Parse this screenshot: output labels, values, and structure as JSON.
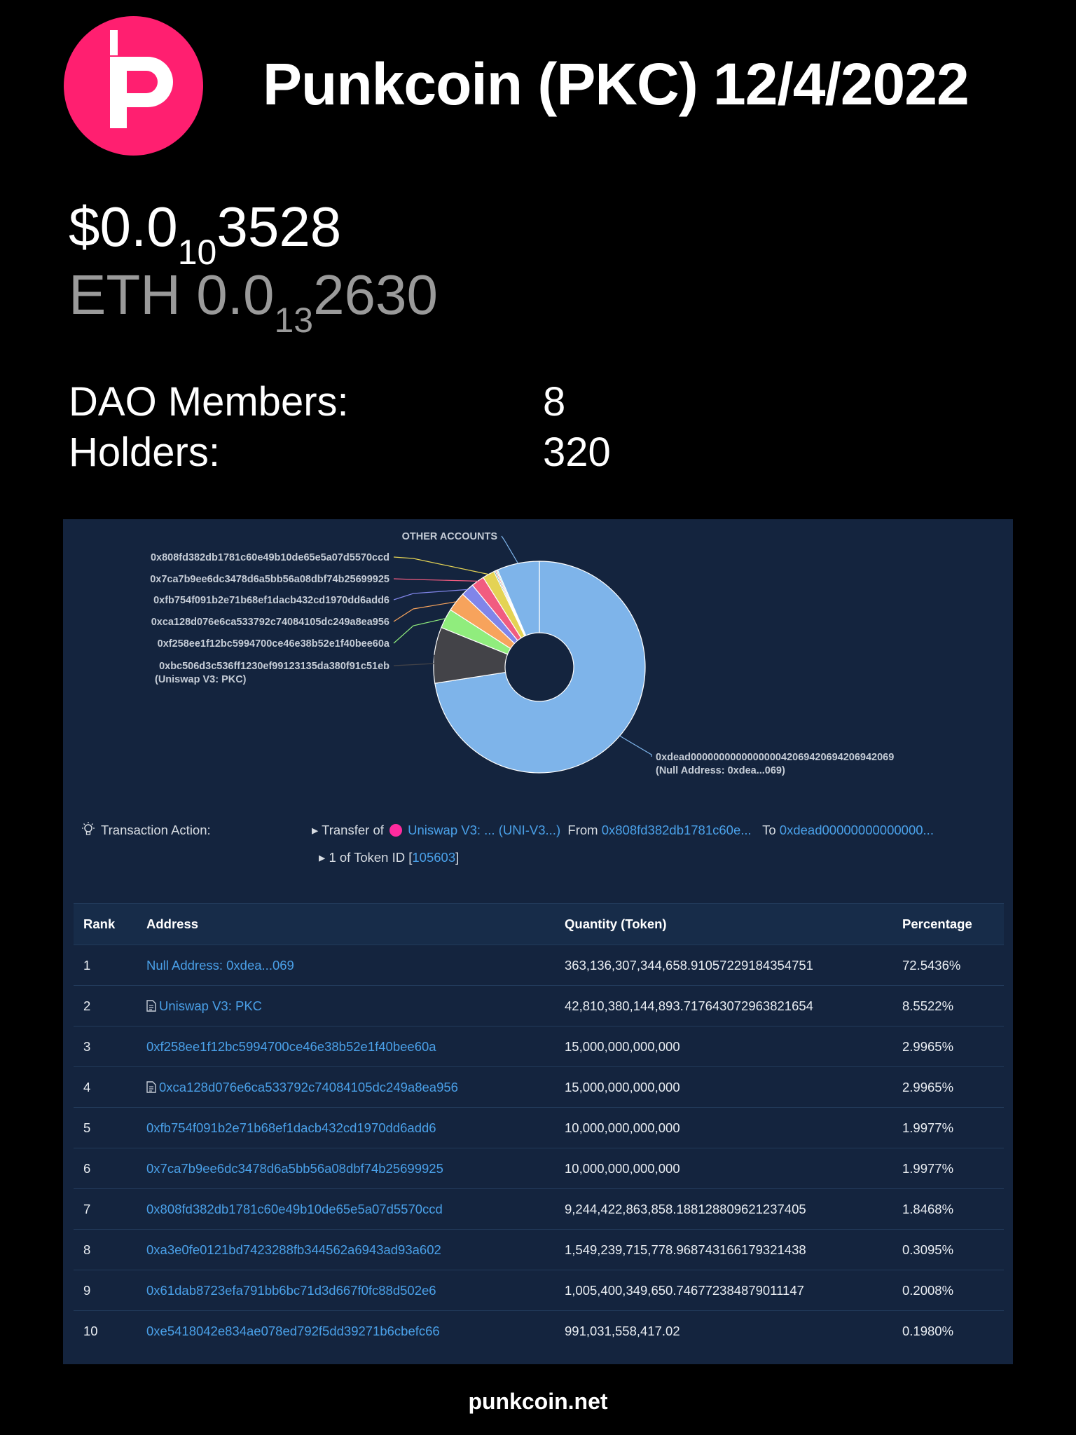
{
  "header": {
    "title": "Punkcoin (PKC) 12/4/2022",
    "logo_icon": "punkcoin-p-logo",
    "logo_color": "#ff1f70"
  },
  "price": {
    "usd_prefix": "$0.0",
    "usd_zeros": "10",
    "usd_digits": "3528",
    "eth_prefix": "ETH 0.0",
    "eth_zeros": "13",
    "eth_digits": "2630"
  },
  "stats": {
    "dao_label": "DAO Members:",
    "dao_value": "8",
    "holders_label": "Holders:",
    "holders_value": "320"
  },
  "chart_data": {
    "type": "pie",
    "style": "donut",
    "series": [
      {
        "label": "0xdead000000000000000042069420694206942069",
        "label2": "(Null Address: 0xdea...069)",
        "value": 72.5436,
        "color": "#7eb4ea"
      },
      {
        "label": "0xbc506d3c536ff1230ef99123135da380f91c51eb",
        "label2": "(Uniswap V3: PKC)",
        "value": 8.5522,
        "color": "#434348"
      },
      {
        "label": "0xf258ee1f12bc5994700ce46e38b52e1f40bee60a",
        "value": 2.9965,
        "color": "#90ed7d"
      },
      {
        "label": "0xca128d076e6ca533792c74084105dc249a8ea956",
        "value": 2.9965,
        "color": "#f7a35c"
      },
      {
        "label": "0xfb754f091b2e71b68ef1dacb432cd1970dd6add6",
        "value": 1.9977,
        "color": "#8085e9"
      },
      {
        "label": "0x7ca7b9ee6dc3478d6a5bb56a08dbf74b25699925",
        "value": 1.9977,
        "color": "#f15c80"
      },
      {
        "label": "0x808fd382db1781c60e49b10de65e5a07d5570ccd",
        "value": 1.8468,
        "color": "#e4d354"
      },
      {
        "label": "",
        "value": 0.2,
        "color": "#2b908f"
      },
      {
        "label": "",
        "value": 0.2,
        "color": "#f45b5b"
      },
      {
        "label": "",
        "value": 0.2,
        "color": "#91e8e1"
      },
      {
        "label": "OTHER ACCOUNTS",
        "value": 6.47,
        "color": "#7eb4ea"
      }
    ]
  },
  "transaction": {
    "label": "Transaction Action:",
    "transfer_of": "Transfer of",
    "token": "Uniswap V3: ... (UNI-V3...)",
    "from_label": "From",
    "from_addr": "0x808fd382db1781c60e...",
    "to_label": "To",
    "to_addr": "0xdead00000000000000...",
    "token_id_prefix": "1 of Token ID [",
    "token_id": "105603",
    "token_id_suffix": "]"
  },
  "table": {
    "headers": {
      "rank": "Rank",
      "address": "Address",
      "quantity": "Quantity (Token)",
      "percentage": "Percentage"
    },
    "rows": [
      {
        "rank": "1",
        "address": "Null Address: 0xdea...069",
        "contract": false,
        "quantity": "363,136,307,344,658.91057229184354751",
        "percentage": "72.5436%"
      },
      {
        "rank": "2",
        "address": "Uniswap V3: PKC",
        "contract": true,
        "quantity": "42,810,380,144,893.717643072963821654",
        "percentage": "8.5522%"
      },
      {
        "rank": "3",
        "address": "0xf258ee1f12bc5994700ce46e38b52e1f40bee60a",
        "contract": false,
        "quantity": "15,000,000,000,000",
        "percentage": "2.9965%"
      },
      {
        "rank": "4",
        "address": "0xca128d076e6ca533792c74084105dc249a8ea956",
        "contract": true,
        "quantity": "15,000,000,000,000",
        "percentage": "2.9965%"
      },
      {
        "rank": "5",
        "address": "0xfb754f091b2e71b68ef1dacb432cd1970dd6add6",
        "contract": false,
        "quantity": "10,000,000,000,000",
        "percentage": "1.9977%"
      },
      {
        "rank": "6",
        "address": "0x7ca7b9ee6dc3478d6a5bb56a08dbf74b25699925",
        "contract": false,
        "quantity": "10,000,000,000,000",
        "percentage": "1.9977%"
      },
      {
        "rank": "7",
        "address": "0x808fd382db1781c60e49b10de65e5a07d5570ccd",
        "contract": false,
        "quantity": "9,244,422,863,858.188128809621237405",
        "percentage": "1.8468%"
      },
      {
        "rank": "8",
        "address": "0xa3e0fe0121bd7423288fb344562a6943ad93a602",
        "contract": false,
        "quantity": "1,549,239,715,778.968743166179321438",
        "percentage": "0.3095%"
      },
      {
        "rank": "9",
        "address": "0x61dab8723efa791bb6bc71d3d667f0fc88d502e6",
        "contract": false,
        "quantity": "1,005,400,349,650.746772384879011147",
        "percentage": "0.2008%"
      },
      {
        "rank": "10",
        "address": "0xe5418042e834ae078ed792f5dd39271b6cbefc66",
        "contract": false,
        "quantity": "991,031,558,417.02",
        "percentage": "0.1980%"
      }
    ]
  },
  "footer": {
    "text": "punkcoin.net"
  }
}
